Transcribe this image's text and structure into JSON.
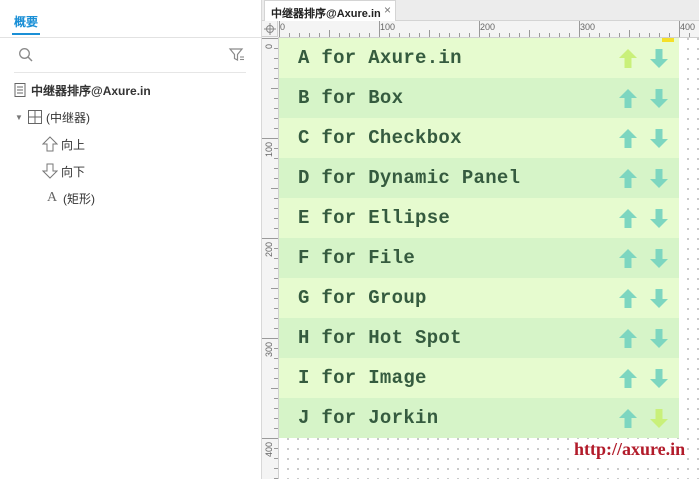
{
  "outline": {
    "tab_label": "概要",
    "tree": {
      "page": "中继器排序@Axure.in",
      "repeater": "(中继器)",
      "children": [
        "向上",
        "向下",
        "(矩形)"
      ]
    }
  },
  "editor": {
    "tab_label": "中继器排序@Axure.in",
    "tab_close": "×",
    "ruler_top_labels": [
      "0",
      "100",
      "200",
      "300",
      "400"
    ],
    "ruler_left_labels": [
      "0",
      "100",
      "200",
      "300",
      "400"
    ]
  },
  "repeater": {
    "rows": [
      {
        "text": "A for Axure.in",
        "up_color": "#c9f07a",
        "down_color": "#7dd6c0"
      },
      {
        "text": "B for Box",
        "up_color": "#7dd6c0",
        "down_color": "#7dd6c0"
      },
      {
        "text": "C for Checkbox",
        "up_color": "#7dd6c0",
        "down_color": "#7dd6c0"
      },
      {
        "text": "D for Dynamic Panel",
        "up_color": "#7dd6c0",
        "down_color": "#7dd6c0"
      },
      {
        "text": "E for Ellipse",
        "up_color": "#7dd6c0",
        "down_color": "#7dd6c0"
      },
      {
        "text": "F for File",
        "up_color": "#7dd6c0",
        "down_color": "#7dd6c0"
      },
      {
        "text": "G for Group",
        "up_color": "#7dd6c0",
        "down_color": "#7dd6c0"
      },
      {
        "text": "H for Hot Spot",
        "up_color": "#7dd6c0",
        "down_color": "#7dd6c0"
      },
      {
        "text": "I for Image",
        "up_color": "#7dd6c0",
        "down_color": "#7dd6c0"
      },
      {
        "text": "J for Jorkin",
        "up_color": "#7dd6c0",
        "down_color": "#c9f07a"
      }
    ],
    "row_color_odd": "#e6fbcf",
    "row_color_even": "#d6f4c8"
  },
  "watermark": "http://axure.in",
  "colors": {
    "accent": "#1a8fd6",
    "row_text": "#355b3f",
    "watermark": "#b21b2a"
  }
}
